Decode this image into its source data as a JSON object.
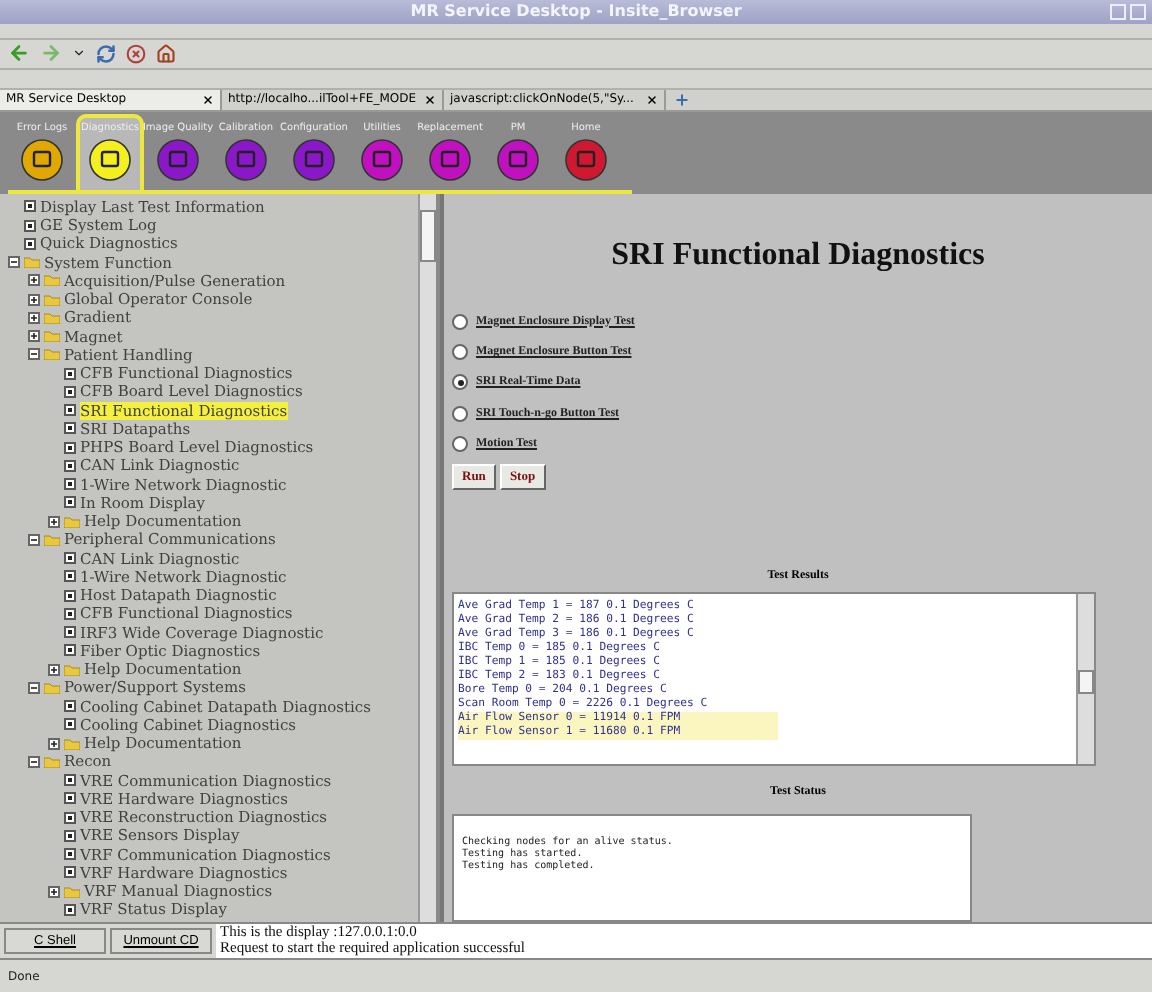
{
  "window": {
    "title": "MR Service Desktop - Insite_Browser"
  },
  "browser_tabs": [
    {
      "label": "MR Service Desktop",
      "selected": true
    },
    {
      "label": "http://localho...ilTool+FE_MODE",
      "selected": false
    },
    {
      "label": "javascript:clickOnNode(5,\"Sy...",
      "selected": false
    }
  ],
  "nav": [
    {
      "label": "Error Logs",
      "color": "#e0a800",
      "selected": false
    },
    {
      "label": "Diagnostics",
      "color": "#f4f020",
      "selected": true
    },
    {
      "label": "Image Quality",
      "color": "#8a18c8",
      "selected": false
    },
    {
      "label": "Calibration",
      "color": "#8a18c8",
      "selected": false
    },
    {
      "label": "Configuration",
      "color": "#8a18c8",
      "selected": false
    },
    {
      "label": "Utilities",
      "color": "#c010c0",
      "selected": false
    },
    {
      "label": "Replacement",
      "color": "#c010c0",
      "selected": false
    },
    {
      "label": "PM",
      "color": "#c010c0",
      "selected": false
    },
    {
      "label": "Home",
      "color": "#d01830",
      "selected": false
    }
  ],
  "tree": [
    {
      "kind": "test",
      "label": "Display Last Test Information",
      "selected": false
    },
    {
      "kind": "test",
      "label": "GE System Log",
      "selected": false
    },
    {
      "kind": "test",
      "label": "Quick Diagnostics",
      "selected": false
    },
    {
      "kind": "folder",
      "label": "System Function",
      "expanded": true,
      "children": [
        {
          "kind": "folder",
          "label": "Acquisition/Pulse Generation",
          "expanded": false
        },
        {
          "kind": "folder",
          "label": "Global Operator Console",
          "expanded": false
        },
        {
          "kind": "folder",
          "label": "Gradient",
          "expanded": false
        },
        {
          "kind": "folder",
          "label": "Magnet",
          "expanded": false
        },
        {
          "kind": "folder",
          "label": "Patient Handling",
          "expanded": true,
          "children": [
            {
              "kind": "test",
              "label": "CFB Functional Diagnostics",
              "selected": false
            },
            {
              "kind": "test",
              "label": "CFB Board Level Diagnostics",
              "selected": false
            },
            {
              "kind": "test",
              "label": "SRI Functional Diagnostics",
              "selected": true
            },
            {
              "kind": "test",
              "label": "SRI Datapaths",
              "selected": false
            },
            {
              "kind": "test",
              "label": "PHPS Board Level Diagnostics",
              "selected": false
            },
            {
              "kind": "test",
              "label": "CAN Link Diagnostic",
              "selected": false
            },
            {
              "kind": "test",
              "label": "1-Wire Network Diagnostic",
              "selected": false
            },
            {
              "kind": "test",
              "label": "In Room Display",
              "selected": false
            },
            {
              "kind": "folder",
              "label": "Help Documentation",
              "expanded": false
            }
          ]
        },
        {
          "kind": "folder",
          "label": "Peripheral Communications",
          "expanded": true,
          "children": [
            {
              "kind": "test",
              "label": "CAN Link Diagnostic",
              "selected": false
            },
            {
              "kind": "test",
              "label": "1-Wire Network Diagnostic",
              "selected": false
            },
            {
              "kind": "test",
              "label": "Host Datapath Diagnostic",
              "selected": false
            },
            {
              "kind": "test",
              "label": "CFB Functional Diagnostics",
              "selected": false
            },
            {
              "kind": "test",
              "label": "IRF3 Wide Coverage Diagnostic",
              "selected": false
            },
            {
              "kind": "test",
              "label": "Fiber Optic Diagnostics",
              "selected": false
            },
            {
              "kind": "folder",
              "label": "Help Documentation",
              "expanded": false
            }
          ]
        },
        {
          "kind": "folder",
          "label": "Power/Support Systems",
          "expanded": true,
          "children": [
            {
              "kind": "test",
              "label": "Cooling Cabinet Datapath Diagnostics",
              "selected": false
            },
            {
              "kind": "test",
              "label": "Cooling Cabinet Diagnostics",
              "selected": false
            },
            {
              "kind": "folder",
              "label": "Help Documentation",
              "expanded": false
            }
          ]
        },
        {
          "kind": "folder",
          "label": "Recon",
          "expanded": true,
          "children": [
            {
              "kind": "test",
              "label": "VRE Communication Diagnostics",
              "selected": false
            },
            {
              "kind": "test",
              "label": "VRE Hardware Diagnostics",
              "selected": false
            },
            {
              "kind": "test",
              "label": "VRE Reconstruction Diagnostics",
              "selected": false
            },
            {
              "kind": "test",
              "label": "VRE Sensors Display",
              "selected": false
            },
            {
              "kind": "test",
              "label": "VRF Communication Diagnostics",
              "selected": false
            },
            {
              "kind": "test",
              "label": "VRF Hardware Diagnostics",
              "selected": false
            },
            {
              "kind": "folder",
              "label": "VRF Manual Diagnostics",
              "expanded": false
            },
            {
              "kind": "test",
              "label": "VRF Status Display",
              "selected": false
            }
          ]
        }
      ]
    }
  ],
  "content": {
    "title": "SRI Functional Diagnostics",
    "options": [
      {
        "label": "Magnet Enclosure Display Test",
        "selected": false
      },
      {
        "label": "Magnet Enclosure Button Test",
        "selected": false
      },
      {
        "label": "SRI Real-Time Data",
        "selected": true
      },
      {
        "label": "SRI Touch-n-go Button Test",
        "selected": false
      },
      {
        "label": "Motion Test",
        "selected": false
      }
    ],
    "buttons": [
      "Run",
      "Stop"
    ],
    "results_heading": "Test Results",
    "results": [
      {
        "text": "Ave Grad Temp 1 = 187 0.1 Degrees C",
        "highlighted": false
      },
      {
        "text": "Ave Grad Temp 2 = 186 0.1 Degrees C",
        "highlighted": false
      },
      {
        "text": "Ave Grad Temp 3 = 186 0.1 Degrees C",
        "highlighted": false
      },
      {
        "text": "IBC Temp 0 = 185 0.1 Degrees C",
        "highlighted": false
      },
      {
        "text": "IBC Temp 1 = 185 0.1 Degrees C",
        "highlighted": false
      },
      {
        "text": "IBC Temp 2 = 183 0.1 Degrees C",
        "highlighted": false
      },
      {
        "text": "Bore Temp 0 = 204 0.1 Degrees C",
        "highlighted": false
      },
      {
        "text": "Scan Room Temp 0 = 2226 0.1 Degrees C",
        "highlighted": false
      },
      {
        "text": "Air Flow Sensor 0 = 11914 0.1 FPM",
        "highlighted": true
      },
      {
        "text": "Air Flow Sensor 1 = 11680 0.1 FPM",
        "highlighted": true
      }
    ],
    "status_heading": "Test Status",
    "status_lines": [
      "Checking nodes for an alive status.",
      "Testing has started.",
      "Testing has completed."
    ]
  },
  "bottom_buttons": [
    "C Shell",
    "Unmount CD"
  ],
  "console": [
    "This is the display :127.0.0.1:0.0",
    "Request to start the required application successful"
  ],
  "status_bar": "Done"
}
